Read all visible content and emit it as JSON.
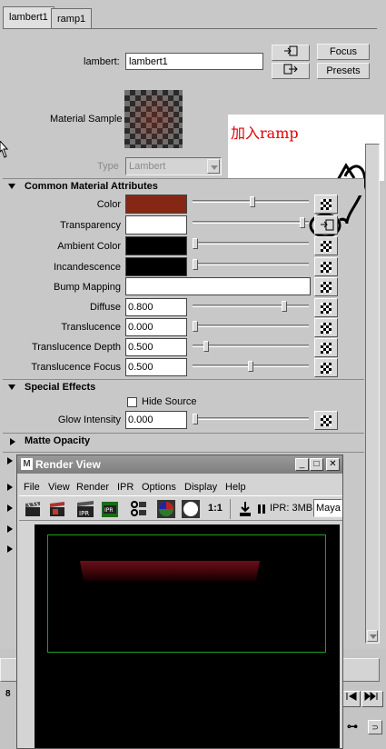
{
  "tabs": [
    {
      "label": "lambert1",
      "active": true
    },
    {
      "label": "ramp1",
      "active": false
    }
  ],
  "header": {
    "name_label": "lambert:",
    "name_value": "lambert1",
    "focus_label": "Focus",
    "presets_label": "Presets",
    "sample_label": "Material Sample",
    "type_label": "Type",
    "type_value": "Lambert"
  },
  "annotation": {
    "text": "加入ramp",
    "color": "#e00000"
  },
  "common": {
    "title": "Common Material Attributes",
    "rows": [
      {
        "label": "Color",
        "kind": "color",
        "swatch": "#862615",
        "slider": 0.52
      },
      {
        "label": "Transparency",
        "kind": "color",
        "swatch": "#ffffff",
        "slider": 0.97
      },
      {
        "label": "Ambient Color",
        "kind": "color",
        "swatch": "#000000",
        "slider": 0.0
      },
      {
        "label": "Incandescence",
        "kind": "color",
        "swatch": "#000000",
        "slider": 0.0
      },
      {
        "label": "Bump Mapping",
        "kind": "map"
      },
      {
        "label": "Diffuse",
        "kind": "number",
        "value": "0.800",
        "slider": 0.8
      },
      {
        "label": "Translucence",
        "kind": "number",
        "value": "0.000",
        "slider": 0.0
      },
      {
        "label": "Translucence Depth",
        "kind": "number",
        "value": "0.500",
        "slider": 0.1
      },
      {
        "label": "Translucence Focus",
        "kind": "number",
        "value": "0.500",
        "slider": 0.5
      }
    ]
  },
  "special": {
    "title": "Special Effects",
    "hide_source_label": "Hide Source",
    "hide_source_checked": false,
    "glow_label": "Glow Intensity",
    "glow_value": "0.000",
    "glow_slider": 0.0
  },
  "matte": {
    "title": "Matte Opacity"
  },
  "render_view": {
    "title": "Render View",
    "menu": [
      "File",
      "View",
      "Render",
      "IPR",
      "Options",
      "Display",
      "Help"
    ],
    "ratio_label": "1:1",
    "ipr_status": "IPR: 3MB",
    "camera": "Maya",
    "tool_icons": [
      "render-clapper-icon",
      "redo-render-icon",
      "ipr-render-icon",
      "ipr-refresh-icon",
      "render-settings-icon",
      "color-wheel-icon",
      "sphere-icon",
      "keep-image-icon",
      "pause-icon"
    ]
  },
  "bottom": {
    "fragment_left": "8",
    "fragment_right": "⊃"
  }
}
